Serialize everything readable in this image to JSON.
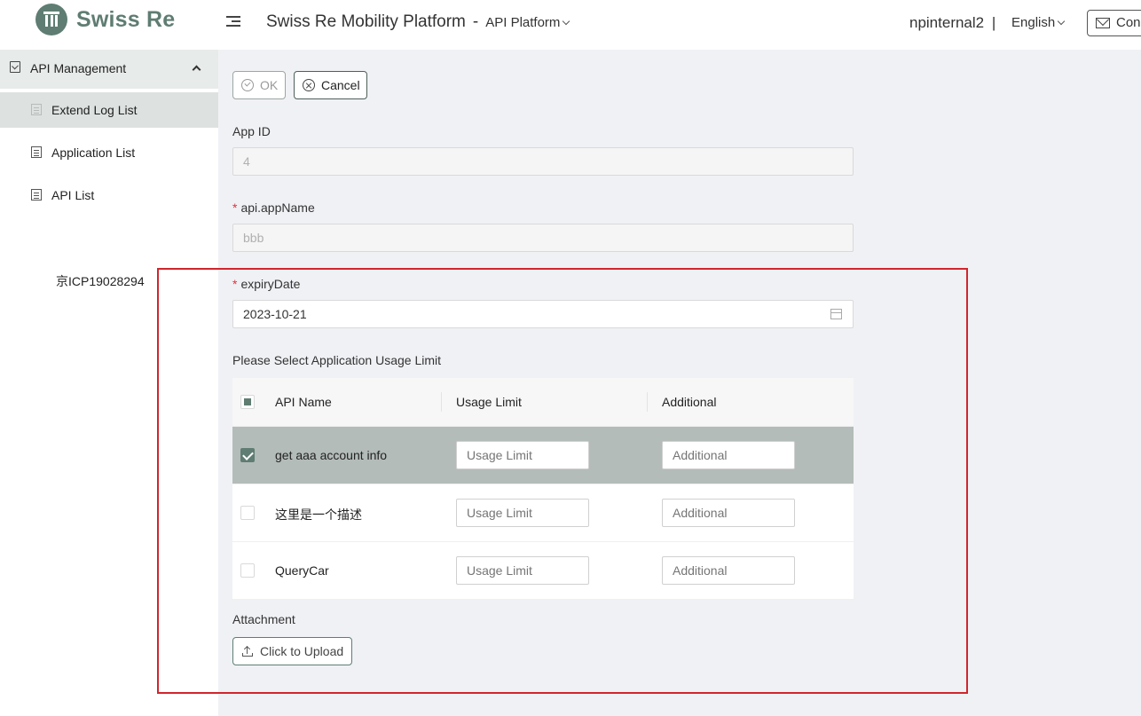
{
  "header": {
    "brand": "Swiss Re",
    "title": "Swiss Re Mobility Platform",
    "title_separator": "-",
    "subtitle": "API Platform",
    "user": "npinternal2",
    "user_separator": "|",
    "language": "English",
    "contact_label": "Con"
  },
  "sidebar": {
    "group_label": "API Management",
    "items": [
      {
        "label": "Extend Log List",
        "active": true
      },
      {
        "label": "Application List",
        "active": false
      },
      {
        "label": "API List",
        "active": false
      }
    ],
    "icp": "京ICP19028294"
  },
  "form": {
    "ok_label": "OK",
    "cancel_label": "Cancel",
    "app_id_label": "App ID",
    "app_id_value": "4",
    "app_name_label": "api.appName",
    "app_name_value": "bbb",
    "required_mark": "*",
    "expiry_label": "expiryDate",
    "expiry_value": "2023-10-21",
    "usage_section_label": "Please Select Application Usage Limit",
    "attachment_label": "Attachment",
    "upload_label": "Click to Upload"
  },
  "table": {
    "columns": [
      "API Name",
      "Usage Limit",
      "Additional"
    ],
    "usage_placeholder": "Usage Limit",
    "additional_placeholder": "Additional",
    "rows": [
      {
        "name": "get aaa account info",
        "checked": true
      },
      {
        "name": "这里是一个描述",
        "checked": false
      },
      {
        "name": "QueryCar",
        "checked": false
      }
    ]
  },
  "colors": {
    "brand": "#5f7d72",
    "selected_row": "#b3bcb8",
    "highlight_border": "#d0262d",
    "required": "#d9363e"
  }
}
